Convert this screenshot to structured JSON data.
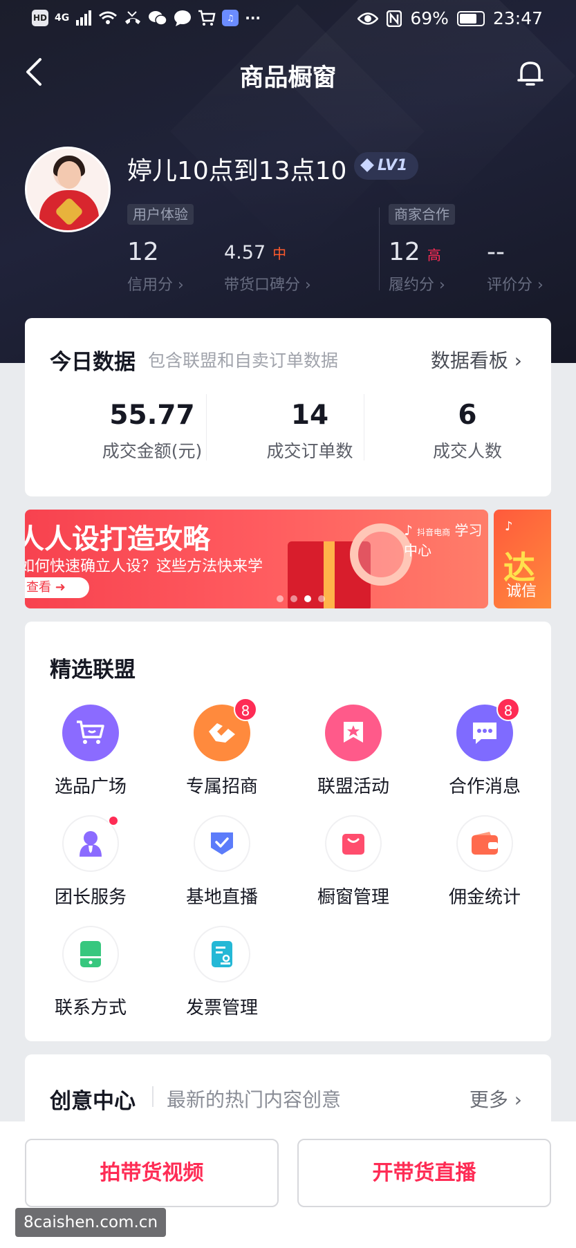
{
  "status_bar": {
    "left_icons": [
      "hd-icon",
      "signal-icon",
      "wifi-icon",
      "missed-call-icon",
      "wechat-icon",
      "message-icon",
      "cart-icon",
      "music-icon"
    ],
    "hd_label": "HD",
    "net_label": "4G",
    "more": "···",
    "battery_percent": "69%",
    "time": "23:47"
  },
  "nav": {
    "title": "商品橱窗",
    "back_icon": "chevron-left-icon",
    "bell_icon": "bell-icon"
  },
  "profile": {
    "name": "婷儿10点到13点10",
    "level": "LV1",
    "tags": {
      "user_exp": "用户体验",
      "merchant_coop": "商家合作"
    },
    "metrics": [
      {
        "value": "12",
        "level": "",
        "label": "信用分 ›"
      },
      {
        "value": "4.57",
        "level": "中",
        "label": "带货口碑分 ›"
      },
      {
        "value": "12",
        "level": "高",
        "label": "履约分 ›"
      },
      {
        "value": "--",
        "level": "",
        "label": "评价分 ›"
      }
    ],
    "level_colors": {
      "中": "#fe5a2c",
      "高": "#fe2c55"
    }
  },
  "today": {
    "title": "今日数据",
    "subtitle": "包含联盟和自卖订单数据",
    "link": "数据看板 ›",
    "stats": [
      {
        "value": "55.77",
        "label": "成交金额(元)"
      },
      {
        "value": "14",
        "label": "成交订单数"
      },
      {
        "value": "6",
        "label": "成交人数"
      }
    ]
  },
  "banner": {
    "headline": "人人设打造攻略",
    "subline": "如何快速确立人设？这些方法快来学",
    "button": "查看",
    "logo": "学习中心",
    "logo_small": "抖音电商",
    "next_headline": "达",
    "next_sub": "诚信",
    "dot_count": 4,
    "active_dot": 3
  },
  "alliance": {
    "title": "精选联盟",
    "items": [
      {
        "label": "选品广场",
        "icon": "cart-icon",
        "badge": "",
        "dot": false,
        "color": "#8b6bff"
      },
      {
        "label": "专属招商",
        "icon": "handshake-icon",
        "badge": "8",
        "dot": false,
        "color": "#ff8a3d"
      },
      {
        "label": "联盟活动",
        "icon": "star-flag-icon",
        "badge": "",
        "dot": false,
        "color": "#ff5a8a"
      },
      {
        "label": "合作消息",
        "icon": "chat-bubble-icon",
        "badge": "8",
        "dot": false,
        "color": "#7f6bff"
      },
      {
        "label": "团长服务",
        "icon": "person-icon",
        "badge": "",
        "dot": true,
        "color": "#8b6bff"
      },
      {
        "label": "基地直播",
        "icon": "shield-check-icon",
        "badge": "",
        "dot": false,
        "color": "#5c7cfa"
      },
      {
        "label": "橱窗管理",
        "icon": "shopping-bag-icon",
        "badge": "",
        "dot": false,
        "color": "#ff4d6d"
      },
      {
        "label": "佣金统计",
        "icon": "wallet-icon",
        "badge": "",
        "dot": false,
        "color": "#ff6a4d"
      },
      {
        "label": "联系方式",
        "icon": "phone-card-icon",
        "badge": "",
        "dot": false,
        "color": "#37c77e"
      },
      {
        "label": "发票管理",
        "icon": "invoice-icon",
        "badge": "",
        "dot": false,
        "color": "#24b8d6"
      }
    ]
  },
  "creative": {
    "title": "创意中心",
    "subtitle": "最新的热门内容创意",
    "more": "更多 ›"
  },
  "bottom": {
    "video_button": "拍带货视频",
    "live_button": "开带货直播"
  },
  "watermark": "8caishen.com.cn",
  "colors": {
    "accent": "#fe2c55",
    "header_bg": "#1b1d2b"
  }
}
